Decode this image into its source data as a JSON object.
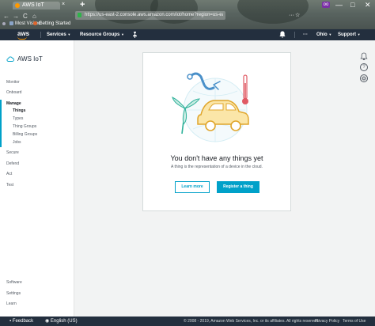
{
  "browser": {
    "tab_title": "AWS IoT",
    "tab_close": "×",
    "new_tab": "+",
    "badge": "oo",
    "win_min": "—",
    "win_max": "□",
    "win_close": "✕",
    "nav_back": "←",
    "nav_forward": "→",
    "nav_reload": "C",
    "nav_home": "⌂",
    "url": "https://us-east-2.console.aws.amazon.com/iot/home?region=us-east-2#/",
    "url_right_1": "···",
    "url_right_2": "☆",
    "bookmarks": [
      {
        "label": "Most Visited",
        "icon_color": "#8aa4c8"
      },
      {
        "label": "Getting Started",
        "icon_color": "#e0662d"
      }
    ]
  },
  "aws_header": {
    "logo": "aws",
    "services": "Services",
    "resource_groups": "Resource Groups",
    "pin_icon": "pin-icon",
    "bell": "♪",
    "region": "Ohio",
    "support": "Support"
  },
  "sidebar": {
    "title": "AWS IoT",
    "top_items": [
      {
        "label": "Monitor"
      },
      {
        "label": "Onboard"
      },
      {
        "label": "Manage"
      }
    ],
    "manage_sub": [
      {
        "label": "Things"
      },
      {
        "label": "Types"
      },
      {
        "label": "Thing Groups"
      },
      {
        "label": "Billing Groups"
      },
      {
        "label": "Jobs"
      }
    ],
    "mid_items": [
      {
        "label": "Secure"
      },
      {
        "label": "Defend"
      },
      {
        "label": "Act"
      },
      {
        "label": "Test"
      }
    ],
    "bottom_items": [
      {
        "label": "Software"
      },
      {
        "label": "Settings"
      },
      {
        "label": "Learn"
      }
    ]
  },
  "right_rail": {
    "help": "?"
  },
  "empty_state": {
    "title": "You don't have any things yet",
    "subtitle": "A thing is the representation of a device in the cloud.",
    "learn_more": "Learn more",
    "register": "Register a thing"
  },
  "footer": {
    "feedback": "Feedback",
    "language": "English (US)",
    "copyright": "© 2008 - 2019, Amazon Web Services, Inc. or its affiliates. All rights reserved.",
    "privacy": "Privacy Policy",
    "terms": "Terms of Use"
  },
  "colors": {
    "accent": "#00a1c9",
    "aws_orange": "#ff9900",
    "header_bg": "#232f3e"
  }
}
